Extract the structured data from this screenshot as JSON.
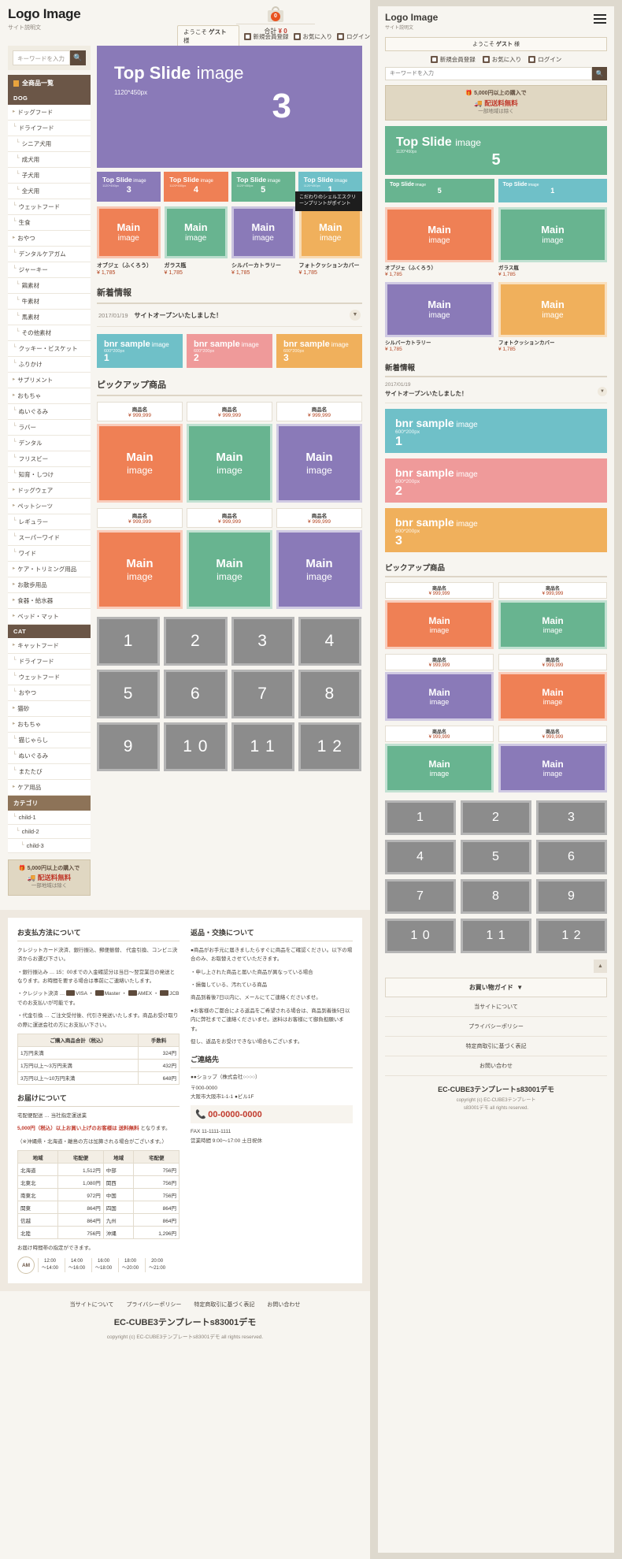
{
  "site": {
    "logo": "Logo Image",
    "tagline": "サイト説明文",
    "cart_count": "0",
    "cart_total_label": "合計",
    "cart_total_value": "¥ 0",
    "guest_greeting": "ようこそ",
    "guest_name": "ゲスト",
    "guest_suffix": "様",
    "nav_links": [
      "新規会員登録",
      "お気に入り",
      "ログイン"
    ],
    "search_placeholder": "キーワードを入力",
    "search_icon": "search-icon"
  },
  "shipping_banner": {
    "line1": "5,000円以上の購入で",
    "line2": "配送料無料",
    "line3": "一部地域は除く"
  },
  "sidebar": {
    "all_products": "全商品一覧",
    "groups": [
      {
        "title": "DOG",
        "items": [
          {
            "label": "ドッグフード",
            "level": 1,
            "marker": "▸"
          },
          {
            "label": "ドライフード",
            "level": 1,
            "marker": "└"
          },
          {
            "label": "シニア犬用",
            "level": 2,
            "marker": "└"
          },
          {
            "label": "成犬用",
            "level": 2,
            "marker": "└"
          },
          {
            "label": "子犬用",
            "level": 2,
            "marker": "└"
          },
          {
            "label": "全犬用",
            "level": 2,
            "marker": "└"
          },
          {
            "label": "ウェットフード",
            "level": 1,
            "marker": "└"
          },
          {
            "label": "生食",
            "level": 1,
            "marker": "└"
          },
          {
            "label": "おやつ",
            "level": 1,
            "marker": "▸"
          },
          {
            "label": "デンタルケアガム",
            "level": 1,
            "marker": "└"
          },
          {
            "label": "ジャーキー",
            "level": 1,
            "marker": "└"
          },
          {
            "label": "鶏素材",
            "level": 2,
            "marker": "└"
          },
          {
            "label": "牛素材",
            "level": 2,
            "marker": "└"
          },
          {
            "label": "馬素材",
            "level": 2,
            "marker": "└"
          },
          {
            "label": "その他素材",
            "level": 2,
            "marker": "└"
          },
          {
            "label": "クッキー・ビスケット",
            "level": 1,
            "marker": "└"
          },
          {
            "label": "ふりかけ",
            "level": 1,
            "marker": "└"
          },
          {
            "label": "サプリメント",
            "level": 1,
            "marker": "▸"
          },
          {
            "label": "おもちゃ",
            "level": 1,
            "marker": "▸"
          },
          {
            "label": "ぬいぐるみ",
            "level": 1,
            "marker": "└"
          },
          {
            "label": "ラバー",
            "level": 1,
            "marker": "└"
          },
          {
            "label": "デンタル",
            "level": 1,
            "marker": "└"
          },
          {
            "label": "フリスビー",
            "level": 1,
            "marker": "└"
          },
          {
            "label": "知育・しつけ",
            "level": 1,
            "marker": "└"
          },
          {
            "label": "ドッグウェア",
            "level": 1,
            "marker": "▸"
          },
          {
            "label": "ペットシーツ",
            "level": 1,
            "marker": "▸"
          },
          {
            "label": "レギュラー",
            "level": 1,
            "marker": "└"
          },
          {
            "label": "スーパーワイド",
            "level": 1,
            "marker": "└"
          },
          {
            "label": "ワイド",
            "level": 1,
            "marker": "└"
          },
          {
            "label": "ケア・トリミング用品",
            "level": 1,
            "marker": "▸"
          },
          {
            "label": "お散歩用品",
            "level": 1,
            "marker": "▸"
          },
          {
            "label": "食器・給水器",
            "level": 1,
            "marker": "▸"
          },
          {
            "label": "ベッド・マット",
            "level": 1,
            "marker": "▸"
          }
        ]
      },
      {
        "title": "CAT",
        "items": [
          {
            "label": "キャットフード",
            "level": 1,
            "marker": "▸"
          },
          {
            "label": "ドライフード",
            "level": 1,
            "marker": "└"
          },
          {
            "label": "ウェットフード",
            "level": 1,
            "marker": "└"
          },
          {
            "label": "おやつ",
            "level": 1,
            "marker": "└"
          },
          {
            "label": "猫砂",
            "level": 1,
            "marker": "▸"
          },
          {
            "label": "おもちゃ",
            "level": 1,
            "marker": "▸"
          },
          {
            "label": "猫じゃらし",
            "level": 1,
            "marker": "└"
          },
          {
            "label": "ぬいぐるみ",
            "level": 1,
            "marker": "└"
          },
          {
            "label": "またたび",
            "level": 1,
            "marker": "└"
          },
          {
            "label": "ケア用品",
            "level": 1,
            "marker": "▸"
          }
        ]
      },
      {
        "title": "カテゴリ",
        "tan": true,
        "items": [
          {
            "label": "child-1",
            "level": 1,
            "marker": "└"
          },
          {
            "label": "child-2",
            "level": 2,
            "marker": "└"
          },
          {
            "label": "child-3",
            "level": 3,
            "marker": "└"
          }
        ]
      }
    ]
  },
  "hero": {
    "title": "Top Slide",
    "title_light": "image",
    "size": "1120*450px",
    "number": "3",
    "color": "#8a7ab8"
  },
  "slide_thumbs": [
    {
      "title": "Top Slide",
      "light": "image",
      "px": "1120*450px",
      "num": "3",
      "color": "#8a7ab8"
    },
    {
      "title": "Top Slide",
      "light": "image",
      "px": "1120*450px",
      "num": "4",
      "color": "#ef8055"
    },
    {
      "title": "Top Slide",
      "light": "image",
      "px": "1120*450px",
      "num": "5",
      "color": "#68b490"
    },
    {
      "title": "Top Slide",
      "light": "image",
      "px": "1120*450px",
      "num": "1",
      "color": "#6fc0c8"
    }
  ],
  "tooltip": "こだわりのシェルエスクリーンプリントがポイント",
  "products": [
    {
      "img_title": "Main",
      "img_sub": "image",
      "name": "オブジェ（ふくろう）",
      "price": "¥ 1,785",
      "color": "#ef8055"
    },
    {
      "img_title": "Main",
      "img_sub": "image",
      "name": "ガラス瓶",
      "price": "¥ 1,785",
      "color": "#68b490"
    },
    {
      "img_title": "Main",
      "img_sub": "image",
      "name": "シルバーカトラリー",
      "price": "¥ 1,785",
      "color": "#8a7ab8"
    },
    {
      "img_title": "Main",
      "img_sub": "image",
      "name": "フォトクッションカバー",
      "price": "¥ 1,785",
      "color": "#f0b05c"
    }
  ],
  "news": {
    "section_title": "新着情報",
    "date": "2017/01/19",
    "text": "サイトオープンいたしました！",
    "caret": "chevron-down-icon"
  },
  "banners": [
    {
      "title": "bnr sample",
      "light": "image",
      "size": "600*200px",
      "num": "1",
      "color": "#6fc0c8"
    },
    {
      "title": "bnr sample",
      "light": "image",
      "size": "600*200px",
      "num": "2",
      "color": "#ef9a9a"
    },
    {
      "title": "bnr sample",
      "light": "image",
      "size": "600*200px",
      "num": "3",
      "color": "#f0b05c"
    }
  ],
  "pickup": {
    "section_title": "ピックアップ商品",
    "items": [
      {
        "name": "商品名",
        "price": "¥ 999,999",
        "img_title": "Main",
        "img_sub": "image",
        "color": "#ef8055"
      },
      {
        "name": "商品名",
        "price": "¥ 999,999",
        "img_title": "Main",
        "img_sub": "image",
        "color": "#68b490"
      },
      {
        "name": "商品名",
        "price": "¥ 999,999",
        "img_title": "Main",
        "img_sub": "image",
        "color": "#8a7ab8"
      },
      {
        "name": "商品名",
        "price": "¥ 999,999",
        "img_title": "Main",
        "img_sub": "image",
        "color": "#ef8055"
      },
      {
        "name": "商品名",
        "price": "¥ 999,999",
        "img_title": "Main",
        "img_sub": "image",
        "color": "#68b490"
      },
      {
        "name": "商品名",
        "price": "¥ 999,999",
        "img_title": "Main",
        "img_sub": "image",
        "color": "#8a7ab8"
      }
    ]
  },
  "number_grid": [
    "1",
    "2",
    "3",
    "4",
    "5",
    "6",
    "7",
    "8",
    "9",
    "1 0",
    "1 1",
    "1 2"
  ],
  "footer_info": {
    "payment": {
      "heading": "お支払方法について",
      "p1": "クレジットカード決済、銀行振込、郵便振替、 代金引換、コンビニ決済からお選び下さい。",
      "p2": "・銀行振込み … 15：00までの入金確認分は当日～翌営業日の発送となります。お時間を要する場合は事前にご連絡いたします。",
      "p3": "・クレジット決済 …  VISA ・  Master ・  AMEX ・  JCBでのお支払いが可能です。",
      "p4": "・代金引換 … ご注文受付後、代引き発送いたします。商品お受け取りの際に運送会社の方にお支払い下さい。",
      "table_headers": [
        "ご購入商品合計（税込）",
        "手数料"
      ],
      "table_rows": [
        [
          "1万円未満",
          "324円"
        ],
        [
          "1万円以上～3万円未満",
          "432円"
        ],
        [
          "3万円以上～10万円未満",
          "648円"
        ]
      ]
    },
    "delivery": {
      "heading": "お届けについて",
      "p1": "宅配便配送 … 当社指定運送業",
      "p2_pre": "5,000円（税込）以上お買い上げのお客様は ",
      "p2_free": "送料無料",
      "p2_post": " となります。",
      "p3": "（※沖縄県・北海道・離島の方は加算される場合がございます。）",
      "table_headers": [
        "地域",
        "宅配便",
        "地域",
        "宅配便"
      ],
      "table_rows": [
        [
          "北海道",
          "1,512円",
          "中部",
          "756円"
        ],
        [
          "北東北",
          "1,080円",
          "関西",
          "756円"
        ],
        [
          "南東北",
          "972円",
          "中国",
          "756円"
        ],
        [
          "関東",
          "864円",
          "四国",
          "864円"
        ],
        [
          "信越",
          "864円",
          "九州",
          "864円"
        ],
        [
          "北陸",
          "756円",
          "沖縄",
          "1,296円"
        ]
      ],
      "time_note": "お届け時間帯の指定ができます。",
      "am_label": "AM",
      "time_slots": [
        "12:00\n～14:00",
        "14:00\n～16:00",
        "16:00\n～18:00",
        "18:00\n～20:00",
        "20:00\n～21:00"
      ]
    },
    "returns": {
      "heading": "返品・交換について",
      "p1": "●商品がお手元に届きましたらすぐに商品をご確認ください。以下の場合のみ、お取替えさせていただきます。",
      "p2": "・申し上された商品と届いた商品が異なっている場合",
      "p3": "・損傷している、汚れている商品",
      "p4": "商品到着後7日以内に、メールにてご連絡くださいませ。",
      "p5": "●お客様のご都合による返品をご希望される場合は、商品到着後5日以内に弊社までご連絡くださいませ。送料はお客様にて御負担願います。",
      "p6": "但し、返品をお受けできない場合もございます。"
    },
    "contact": {
      "heading": "ご連絡先",
      "company": "●●ショップ（株式会社○○○○）",
      "zip": "〒000-0000",
      "address": "大阪市大阪市1-1-1 ●ビル1F",
      "tel": "00-0000-0000",
      "fax": "FAX 11-1111-1111",
      "hours": "営業時間 9:00～17:00  土日祝休"
    }
  },
  "footer": {
    "links": [
      "当サイトについて",
      "プライバシーポリシー",
      "特定商取引に基づく表記",
      "お問い合わせ"
    ],
    "title": "EC-CUBE3テンプレートs83001デモ",
    "copyright": "copyright (c) EC-CUBE3テンプレートs83001デモ all rights reserved."
  },
  "mobile": {
    "hero": {
      "title": "Top Slide",
      "light": "image",
      "px": "1120*450px",
      "num": "5",
      "color": "#68b490"
    },
    "thumbs": [
      {
        "title": "Top Slide",
        "light": "image",
        "num": "5",
        "color": "#68b490"
      },
      {
        "title": "Top Slide",
        "light": "image",
        "num": "1",
        "color": "#6fc0c8"
      }
    ],
    "products": [
      {
        "img_title": "Main",
        "img_sub": "image",
        "name": "オブジェ（ふくろう）",
        "price": "¥ 1,785",
        "color": "#ef8055"
      },
      {
        "img_title": "Main",
        "img_sub": "image",
        "name": "ガラス瓶",
        "price": "¥ 1,785",
        "color": "#68b490"
      },
      {
        "img_title": "Main",
        "img_sub": "image",
        "name": "シルバーカトラリー",
        "price": "¥ 1,785",
        "color": "#8a7ab8"
      },
      {
        "img_title": "Main",
        "img_sub": "image",
        "name": "フォトクッションカバー",
        "price": "¥ 1,785",
        "color": "#f0b05c"
      }
    ],
    "pickup": [
      {
        "name": "商品名",
        "price": "¥ 999,999",
        "img_title": "Main",
        "img_sub": "image",
        "color": "#ef8055"
      },
      {
        "name": "商品名",
        "price": "¥ 999,999",
        "img_title": "Main",
        "img_sub": "image",
        "color": "#68b490"
      },
      {
        "name": "商品名",
        "price": "¥ 999,999",
        "img_title": "Main",
        "img_sub": "image",
        "color": "#8a7ab8"
      },
      {
        "name": "商品名",
        "price": "¥ 999,999",
        "img_title": "Main",
        "img_sub": "image",
        "color": "#ef8055"
      },
      {
        "name": "商品名",
        "price": "¥ 999,999",
        "img_title": "Main",
        "img_sub": "image",
        "color": "#68b490"
      },
      {
        "name": "商品名",
        "price": "¥ 999,999",
        "img_title": "Main",
        "img_sub": "image",
        "color": "#8a7ab8"
      }
    ],
    "numbers": [
      "1",
      "2",
      "3",
      "4",
      "5",
      "6",
      "7",
      "8",
      "9",
      "1 0",
      "1 1",
      "1 2"
    ],
    "back_to_top": "▲",
    "guide_label": "お買い物ガイド",
    "guide_caret": "chevron-down-icon",
    "links": [
      "当サイトについて",
      "プライバシーポリシー",
      "特定商取引に基づく表記",
      "お問い合わせ"
    ],
    "footer_title": "EC-CUBE3テンプレートs83001デモ",
    "copyright": "copyright (c) EC-CUBE3テンプレート\ns83001デモ all rights reserved."
  }
}
